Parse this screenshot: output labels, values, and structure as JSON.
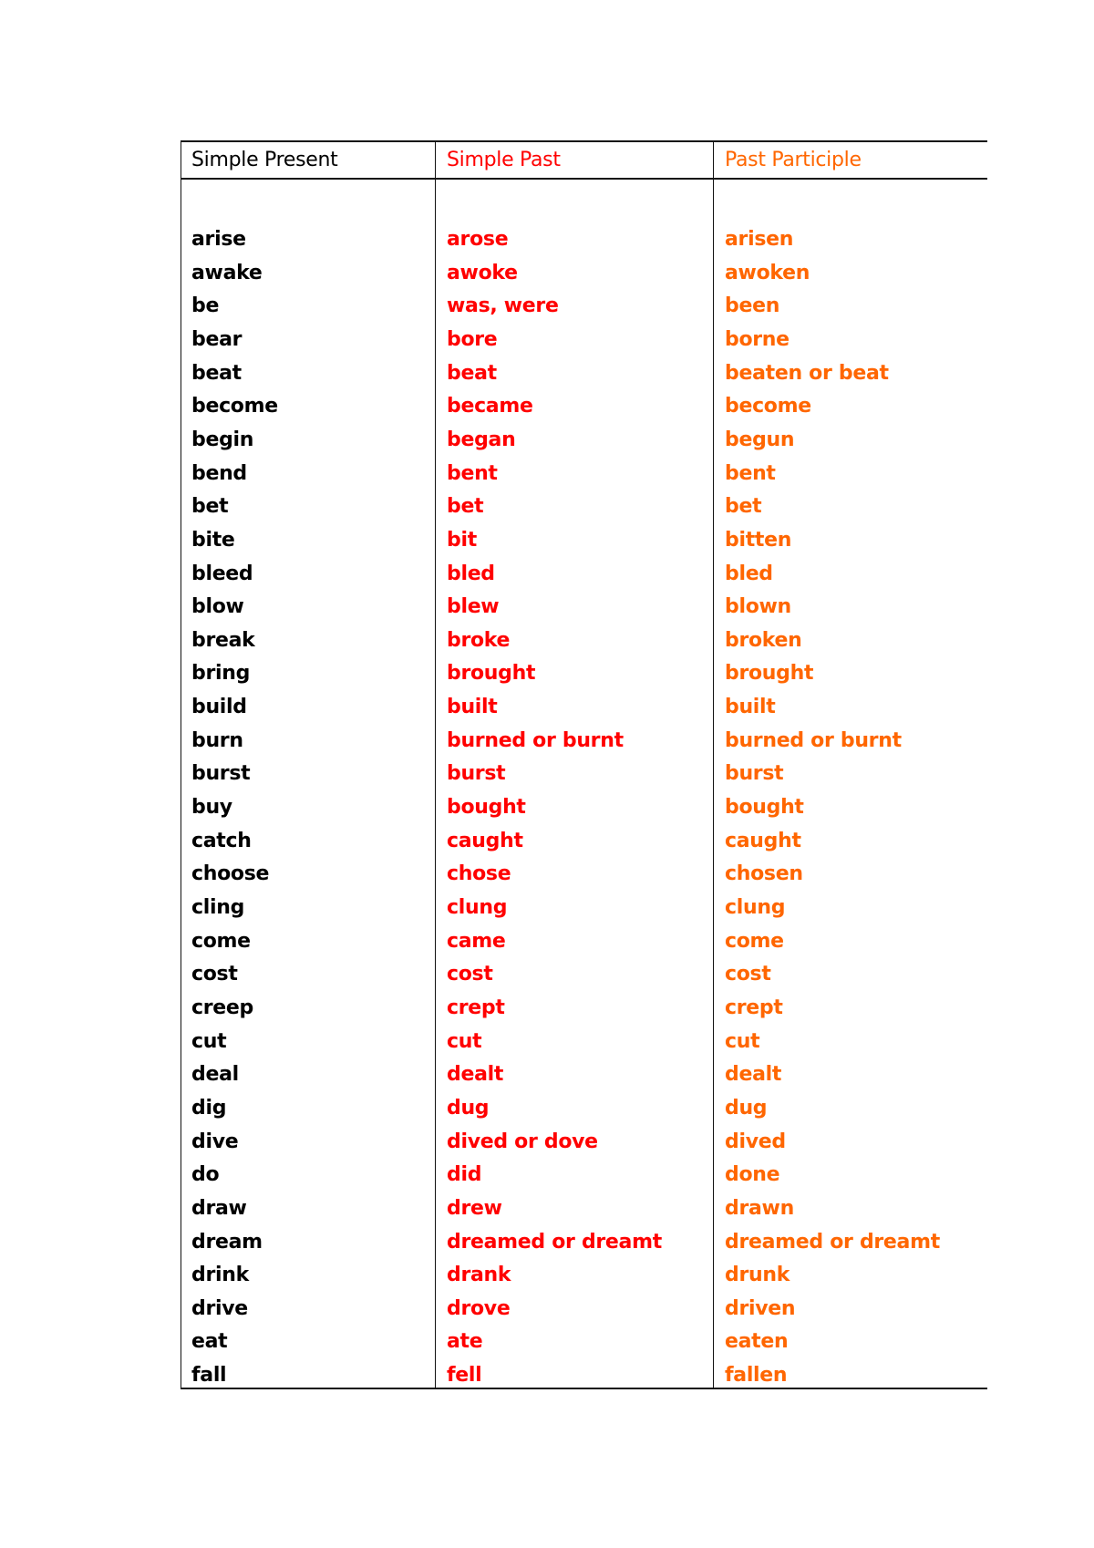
{
  "table": {
    "headers": {
      "present": "Simple Present",
      "past": "Simple Past",
      "participle": "Past Participle"
    },
    "colors": {
      "present": "#000000",
      "past": "#ff0000",
      "participle": "#ff6600"
    },
    "rows": [
      {
        "present": "arise",
        "past": "arose",
        "participle": "arisen"
      },
      {
        "present": "awake",
        "past": "awoke",
        "participle": "awoken"
      },
      {
        "present": "be",
        "past": "was, were",
        "participle": "been"
      },
      {
        "present": "bear",
        "past": "bore",
        "participle": "borne"
      },
      {
        "present": "beat",
        "past": "beat",
        "participle": "beaten or beat"
      },
      {
        "present": "become",
        "past": "became",
        "participle": "become"
      },
      {
        "present": "begin",
        "past": "began",
        "participle": "begun"
      },
      {
        "present": "bend",
        "past": "bent",
        "participle": "bent"
      },
      {
        "present": "bet",
        "past": "bet",
        "participle": "bet"
      },
      {
        "present": "bite",
        "past": "bit",
        "participle": "bitten"
      },
      {
        "present": "bleed",
        "past": "bled",
        "participle": "bled"
      },
      {
        "present": "blow",
        "past": "blew",
        "participle": "blown"
      },
      {
        "present": "break",
        "past": "broke",
        "participle": "broken"
      },
      {
        "present": "bring",
        "past": "brought",
        "participle": "brought"
      },
      {
        "present": "build",
        "past": "built",
        "participle": "built"
      },
      {
        "present": "burn",
        "past": "burned or burnt",
        "participle": "burned or burnt"
      },
      {
        "present": "burst",
        "past": "burst",
        "participle": "burst"
      },
      {
        "present": "buy",
        "past": "bought",
        "participle": "bought"
      },
      {
        "present": "catch",
        "past": "caught",
        "participle": "caught"
      },
      {
        "present": "choose",
        "past": "chose",
        "participle": "chosen"
      },
      {
        "present": "cling",
        "past": "clung",
        "participle": "clung"
      },
      {
        "present": "come",
        "past": "came",
        "participle": "come"
      },
      {
        "present": "cost",
        "past": "cost",
        "participle": "cost"
      },
      {
        "present": "creep",
        "past": "crept",
        "participle": "crept"
      },
      {
        "present": "cut",
        "past": "cut",
        "participle": "cut"
      },
      {
        "present": "deal",
        "past": "dealt",
        "participle": "dealt"
      },
      {
        "present": "dig",
        "past": "dug",
        "participle": "dug"
      },
      {
        "present": "dive",
        "past": "dived or dove",
        "participle": "dived"
      },
      {
        "present": "do",
        "past": "did",
        "participle": "done"
      },
      {
        "present": "draw",
        "past": "drew",
        "participle": "drawn"
      },
      {
        "present": "dream",
        "past": "dreamed or dreamt",
        "participle": "dreamed or dreamt"
      },
      {
        "present": "drink",
        "past": "drank",
        "participle": "drunk"
      },
      {
        "present": "drive",
        "past": "drove",
        "participle": "driven"
      },
      {
        "present": "eat",
        "past": "ate",
        "participle": "eaten"
      },
      {
        "present": "fall",
        "past": "fell",
        "participle": "fallen"
      }
    ]
  }
}
